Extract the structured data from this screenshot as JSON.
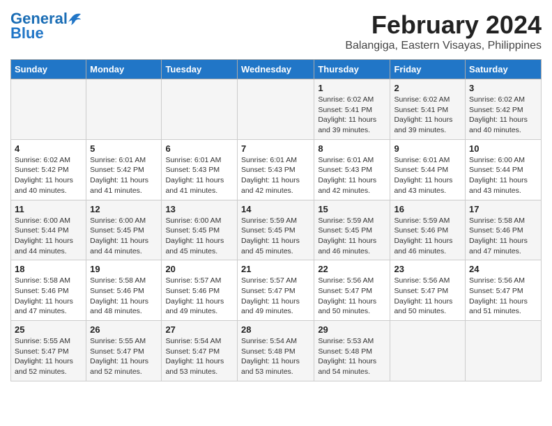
{
  "logo": {
    "line1": "General",
    "line2": "Blue"
  },
  "title": "February 2024",
  "subtitle": "Balangiga, Eastern Visayas, Philippines",
  "weekdays": [
    "Sunday",
    "Monday",
    "Tuesday",
    "Wednesday",
    "Thursday",
    "Friday",
    "Saturday"
  ],
  "weeks": [
    [
      {
        "day": "",
        "info": ""
      },
      {
        "day": "",
        "info": ""
      },
      {
        "day": "",
        "info": ""
      },
      {
        "day": "",
        "info": ""
      },
      {
        "day": "1",
        "info": "Sunrise: 6:02 AM\nSunset: 5:41 PM\nDaylight: 11 hours and 39 minutes."
      },
      {
        "day": "2",
        "info": "Sunrise: 6:02 AM\nSunset: 5:41 PM\nDaylight: 11 hours and 39 minutes."
      },
      {
        "day": "3",
        "info": "Sunrise: 6:02 AM\nSunset: 5:42 PM\nDaylight: 11 hours and 40 minutes."
      }
    ],
    [
      {
        "day": "4",
        "info": "Sunrise: 6:02 AM\nSunset: 5:42 PM\nDaylight: 11 hours and 40 minutes."
      },
      {
        "day": "5",
        "info": "Sunrise: 6:01 AM\nSunset: 5:42 PM\nDaylight: 11 hours and 41 minutes."
      },
      {
        "day": "6",
        "info": "Sunrise: 6:01 AM\nSunset: 5:43 PM\nDaylight: 11 hours and 41 minutes."
      },
      {
        "day": "7",
        "info": "Sunrise: 6:01 AM\nSunset: 5:43 PM\nDaylight: 11 hours and 42 minutes."
      },
      {
        "day": "8",
        "info": "Sunrise: 6:01 AM\nSunset: 5:43 PM\nDaylight: 11 hours and 42 minutes."
      },
      {
        "day": "9",
        "info": "Sunrise: 6:01 AM\nSunset: 5:44 PM\nDaylight: 11 hours and 43 minutes."
      },
      {
        "day": "10",
        "info": "Sunrise: 6:00 AM\nSunset: 5:44 PM\nDaylight: 11 hours and 43 minutes."
      }
    ],
    [
      {
        "day": "11",
        "info": "Sunrise: 6:00 AM\nSunset: 5:44 PM\nDaylight: 11 hours and 44 minutes."
      },
      {
        "day": "12",
        "info": "Sunrise: 6:00 AM\nSunset: 5:45 PM\nDaylight: 11 hours and 44 minutes."
      },
      {
        "day": "13",
        "info": "Sunrise: 6:00 AM\nSunset: 5:45 PM\nDaylight: 11 hours and 45 minutes."
      },
      {
        "day": "14",
        "info": "Sunrise: 5:59 AM\nSunset: 5:45 PM\nDaylight: 11 hours and 45 minutes."
      },
      {
        "day": "15",
        "info": "Sunrise: 5:59 AM\nSunset: 5:45 PM\nDaylight: 11 hours and 46 minutes."
      },
      {
        "day": "16",
        "info": "Sunrise: 5:59 AM\nSunset: 5:46 PM\nDaylight: 11 hours and 46 minutes."
      },
      {
        "day": "17",
        "info": "Sunrise: 5:58 AM\nSunset: 5:46 PM\nDaylight: 11 hours and 47 minutes."
      }
    ],
    [
      {
        "day": "18",
        "info": "Sunrise: 5:58 AM\nSunset: 5:46 PM\nDaylight: 11 hours and 47 minutes."
      },
      {
        "day": "19",
        "info": "Sunrise: 5:58 AM\nSunset: 5:46 PM\nDaylight: 11 hours and 48 minutes."
      },
      {
        "day": "20",
        "info": "Sunrise: 5:57 AM\nSunset: 5:46 PM\nDaylight: 11 hours and 49 minutes."
      },
      {
        "day": "21",
        "info": "Sunrise: 5:57 AM\nSunset: 5:47 PM\nDaylight: 11 hours and 49 minutes."
      },
      {
        "day": "22",
        "info": "Sunrise: 5:56 AM\nSunset: 5:47 PM\nDaylight: 11 hours and 50 minutes."
      },
      {
        "day": "23",
        "info": "Sunrise: 5:56 AM\nSunset: 5:47 PM\nDaylight: 11 hours and 50 minutes."
      },
      {
        "day": "24",
        "info": "Sunrise: 5:56 AM\nSunset: 5:47 PM\nDaylight: 11 hours and 51 minutes."
      }
    ],
    [
      {
        "day": "25",
        "info": "Sunrise: 5:55 AM\nSunset: 5:47 PM\nDaylight: 11 hours and 52 minutes."
      },
      {
        "day": "26",
        "info": "Sunrise: 5:55 AM\nSunset: 5:47 PM\nDaylight: 11 hours and 52 minutes."
      },
      {
        "day": "27",
        "info": "Sunrise: 5:54 AM\nSunset: 5:47 PM\nDaylight: 11 hours and 53 minutes."
      },
      {
        "day": "28",
        "info": "Sunrise: 5:54 AM\nSunset: 5:48 PM\nDaylight: 11 hours and 53 minutes."
      },
      {
        "day": "29",
        "info": "Sunrise: 5:53 AM\nSunset: 5:48 PM\nDaylight: 11 hours and 54 minutes."
      },
      {
        "day": "",
        "info": ""
      },
      {
        "day": "",
        "info": ""
      }
    ]
  ]
}
